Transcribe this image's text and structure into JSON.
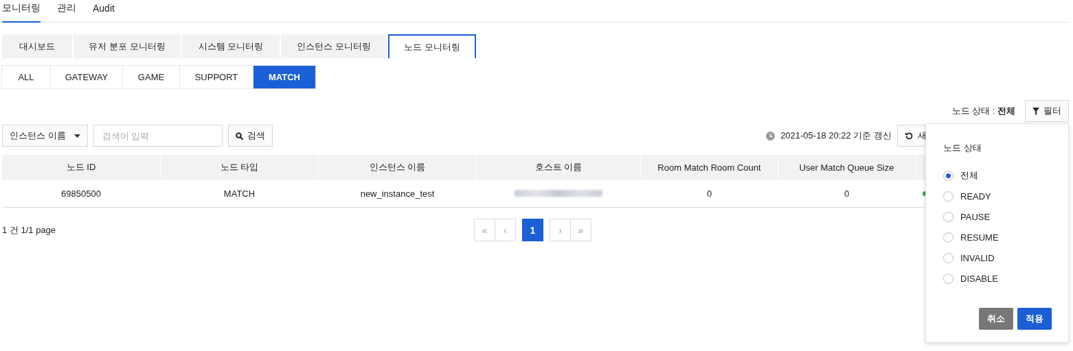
{
  "top_nav": [
    {
      "label": "모니터링",
      "selected": true
    },
    {
      "label": "관리",
      "selected": false
    },
    {
      "label": "Audit",
      "selected": false
    }
  ],
  "tabs": [
    {
      "label": "대시보드",
      "selected": false
    },
    {
      "label": "유저 분포 모니터링",
      "selected": false
    },
    {
      "label": "시스템 모니터링",
      "selected": false
    },
    {
      "label": "인스턴스 모니터링",
      "selected": false
    },
    {
      "label": "노드 모니터링",
      "selected": true
    }
  ],
  "sub_tabs": [
    {
      "label": "ALL",
      "selected": false
    },
    {
      "label": "GATEWAY",
      "selected": false
    },
    {
      "label": "GAME",
      "selected": false
    },
    {
      "label": "SUPPORT",
      "selected": false
    },
    {
      "label": "MATCH",
      "selected": true
    }
  ],
  "status_filter": {
    "label": "노드 상태 :",
    "value": "전체",
    "button": "필터"
  },
  "search": {
    "dropdown": "인스턴스 이름",
    "placeholder": "검색어 입력",
    "button": "검색"
  },
  "updated": "2021-05-18 20:22 기준 갱신",
  "refresh_button": "새",
  "table": {
    "columns": [
      "노드 ID",
      "노드 타입",
      "인스턴스 이름",
      "호스트 이름",
      "Room Match Room Count",
      "User Match Queue Size"
    ],
    "rows": [
      {
        "cells": [
          "69850500",
          "MATCH",
          "new_instance_test",
          "",
          "0",
          "0"
        ],
        "status": {
          "color": "#22a447"
        }
      }
    ]
  },
  "summary": "1 건 1/1 page",
  "pagination": {
    "first": "«",
    "prev": "‹",
    "pages": [
      {
        "label": "1",
        "selected": true
      }
    ],
    "next": "›",
    "last": "»"
  },
  "filter_popup": {
    "title": "노드 상태",
    "options": [
      {
        "label": "전체",
        "selected": true
      },
      {
        "label": "READY",
        "selected": false
      },
      {
        "label": "PAUSE",
        "selected": false
      },
      {
        "label": "RESUME",
        "selected": false
      },
      {
        "label": "INVALID",
        "selected": false
      },
      {
        "label": "DISABLE",
        "selected": false
      }
    ],
    "cancel": "취소",
    "apply": "적용"
  }
}
